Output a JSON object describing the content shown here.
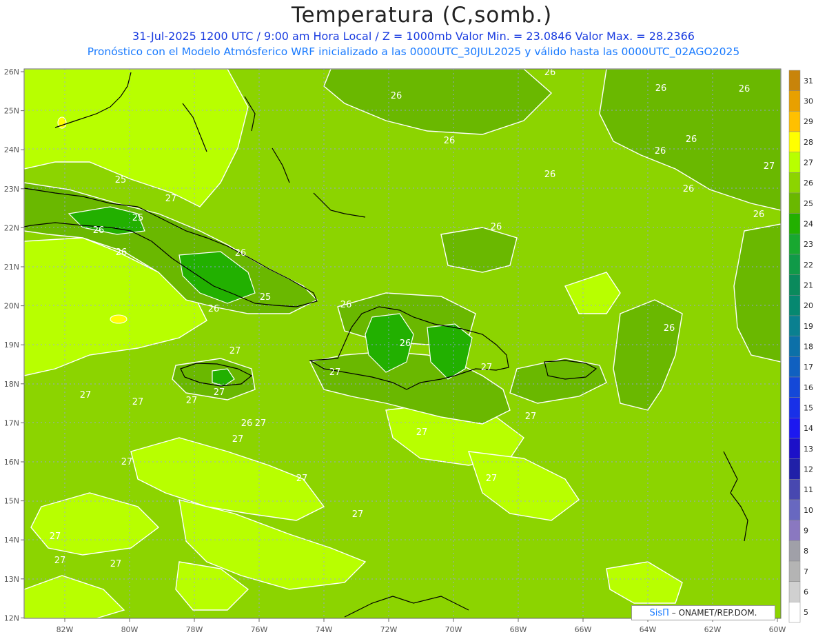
{
  "title": "Temperatura (C,somb.)",
  "subtitle_line1": "31-Jul-2025  1200 UTC / 9:00 am Hora Local / Z = 1000mb   Valor Min. = 23.0846  Valor Max. = 28.2366",
  "subtitle_line2": "Pronóstico con el Modelo Atmósferico WRF inicializado a las 0000UTC_30JUL2025 y válido hasta las  0000UTC_02AGO2025",
  "credit": {
    "brand": "SisΠ",
    "text": " – ONAMET/REP.DOM."
  },
  "axes": {
    "lat_labels": [
      "26N",
      "25N",
      "24N",
      "23N",
      "22N",
      "21N",
      "20N",
      "19N",
      "18N",
      "17N",
      "16N",
      "15N",
      "14N",
      "13N",
      "12N"
    ],
    "lon_labels": [
      "82W",
      "80W",
      "78W",
      "76W",
      "74W",
      "72W",
      "70W",
      "68W",
      "66W",
      "64W",
      "62W",
      "60W"
    ]
  },
  "colorbar": {
    "levels": [
      "31",
      "30",
      "29",
      "28",
      "27",
      "26",
      "25",
      "24",
      "23",
      "22",
      "21",
      "20",
      "19",
      "18",
      "17",
      "16",
      "15",
      "14",
      "13",
      "12",
      "11",
      "10",
      "9",
      "8",
      "7",
      "6",
      "5"
    ],
    "colors": [
      "#c8840a",
      "#e8a000",
      "#ffc000",
      "#ffff00",
      "#b8ff00",
      "#8cd400",
      "#6ab800",
      "#22b000",
      "#18a830",
      "#109a48",
      "#0a8a5c",
      "#068870",
      "#0a8090",
      "#0c70a8",
      "#1060c0",
      "#1448d8",
      "#1830e8",
      "#1c18f0",
      "#1c10c8",
      "#2020a8",
      "#4848b0",
      "#6868c0",
      "#8a78c0",
      "#a0a0a8",
      "#b4b4b4",
      "#d0d0d0",
      "#ffffff"
    ]
  },
  "contour_labels": [
    "26",
    "26",
    "26",
    "26",
    "26",
    "26",
    "26",
    "27",
    "26",
    "25",
    "27",
    "26",
    "26",
    "26",
    "25",
    "26",
    "26",
    "26",
    "26",
    "26",
    "25",
    "26",
    "26",
    "27",
    "27",
    "27",
    "27",
    "27",
    "27",
    "27",
    "27",
    "26",
    "27",
    "27",
    "27",
    "27",
    "27",
    "27",
    "27",
    "27",
    "27",
    "27"
  ]
}
